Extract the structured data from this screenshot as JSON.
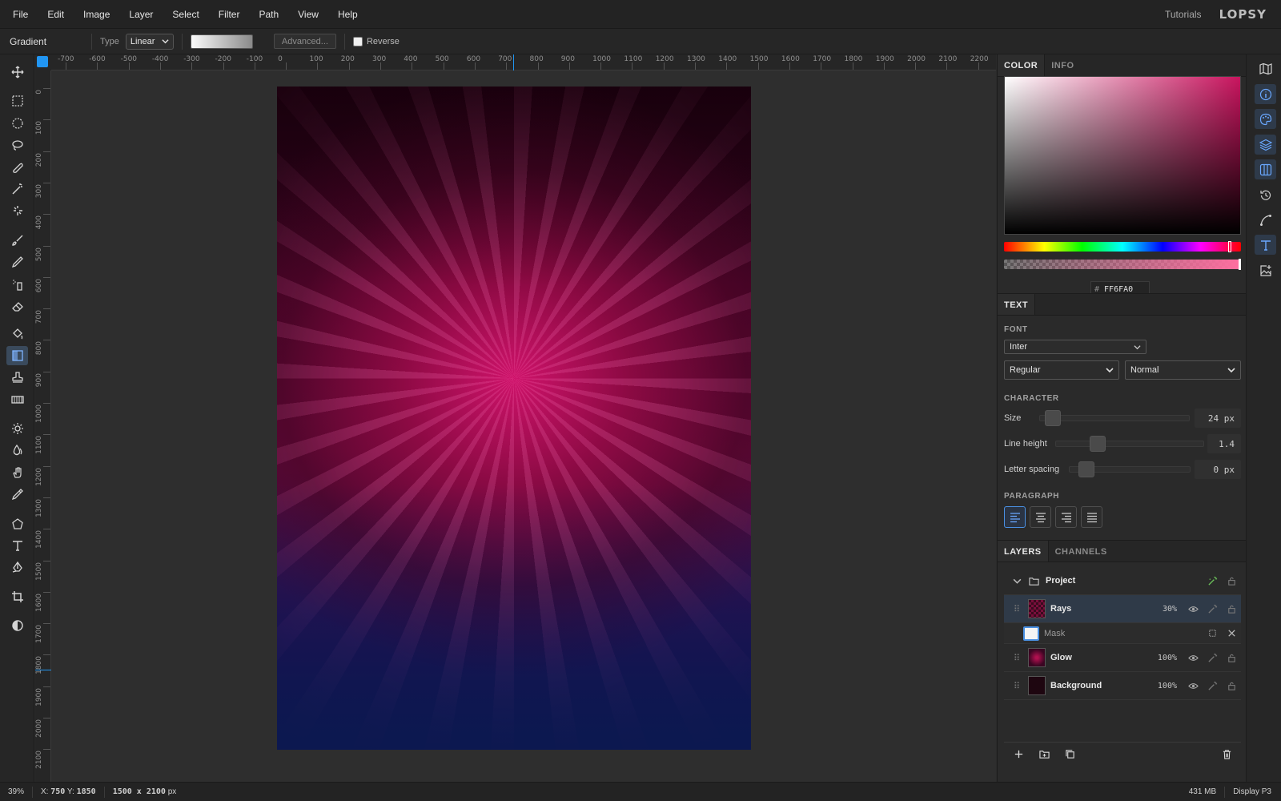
{
  "menubar": {
    "items": [
      "File",
      "Edit",
      "Image",
      "Layer",
      "Select",
      "Filter",
      "Path",
      "View",
      "Help"
    ],
    "tutorials": "Tutorials",
    "logo": "LOPSY"
  },
  "options": {
    "tool_name": "Gradient",
    "type_label": "Type",
    "type_value": "Linear",
    "advanced_label": "Advanced...",
    "reverse_label": "Reverse",
    "reverse_checked": false
  },
  "tools": [
    {
      "name": "move-tool",
      "icon": "move-icon"
    },
    {
      "name": "rect-select-tool",
      "icon": "rect-select-icon"
    },
    {
      "name": "ellipse-select-tool",
      "icon": "ellipse-select-icon"
    },
    {
      "name": "lasso-tool",
      "icon": "lasso-icon"
    },
    {
      "name": "magnetic-lasso-tool",
      "icon": "magnetic-lasso-icon"
    },
    {
      "name": "magic-wand-tool",
      "icon": "magic-wand-icon"
    },
    {
      "name": "quick-select-tool",
      "icon": "quick-select-icon"
    },
    {
      "name": "brush-tool",
      "icon": "brush-icon"
    },
    {
      "name": "pencil-tool",
      "icon": "pencil-icon"
    },
    {
      "name": "spray-tool",
      "icon": "spray-icon"
    },
    {
      "name": "eraser-tool",
      "icon": "eraser-icon"
    },
    {
      "name": "fill-tool",
      "icon": "bucket-icon"
    },
    {
      "name": "gradient-tool",
      "icon": "gradient-icon",
      "active": true
    },
    {
      "name": "stamp-tool",
      "icon": "stamp-icon"
    },
    {
      "name": "pattern-tool",
      "icon": "pattern-icon"
    },
    {
      "name": "dodge-tool",
      "icon": "sun-icon"
    },
    {
      "name": "blur-tool",
      "icon": "drop-icon"
    },
    {
      "name": "smudge-tool",
      "icon": "hand-icon"
    },
    {
      "name": "eyedropper-tool",
      "icon": "eyedropper-icon"
    },
    {
      "name": "shape-tool",
      "icon": "pentagon-icon"
    },
    {
      "name": "text-tool",
      "icon": "text-icon"
    },
    {
      "name": "pen-tool",
      "icon": "pen-icon"
    },
    {
      "name": "crop-tool",
      "icon": "crop-icon"
    },
    {
      "name": "adjust-tool",
      "icon": "contrast-icon"
    }
  ],
  "ruler": {
    "h_labels": [
      "-700",
      "-600",
      "-500",
      "-400",
      "-300",
      "-200",
      "-100",
      "0",
      "100",
      "200",
      "300",
      "400",
      "500",
      "600",
      "700",
      "800",
      "900",
      "1000",
      "1100",
      "1200",
      "1300",
      "1400",
      "1500",
      "1600",
      "1700",
      "1800",
      "1900",
      "2000",
      "2100",
      "2200"
    ],
    "v_labels": [
      "0",
      "100",
      "200",
      "300",
      "400",
      "500",
      "600",
      "700",
      "800",
      "900",
      "1000",
      "1100",
      "1200",
      "1300",
      "1400",
      "1500",
      "1600",
      "1700",
      "1800",
      "1900",
      "2000",
      "2100"
    ]
  },
  "color_panel": {
    "tabs": [
      "COLOR",
      "INFO"
    ],
    "hex_value": "FF6FA0",
    "hue_color": "#c8145e"
  },
  "text_panel": {
    "tab": "TEXT",
    "font_label": "FONT",
    "font_family": "Inter",
    "font_style": "Regular",
    "font_case": "Normal",
    "character_label": "CHARACTER",
    "size_label": "Size",
    "size_value": "24 px",
    "line_height_label": "Line height",
    "line_height_value": "1.4",
    "letter_spacing_label": "Letter spacing",
    "letter_spacing_value": "0 px",
    "paragraph_label": "PARAGRAPH"
  },
  "layers_panel": {
    "tabs": [
      "LAYERS",
      "CHANNELS"
    ],
    "group_name": "Project",
    "layers": [
      {
        "name": "Rays",
        "opacity": "30%"
      },
      {
        "name": "Mask"
      },
      {
        "name": "Glow",
        "opacity": "100%"
      },
      {
        "name": "Background",
        "opacity": "100%"
      }
    ]
  },
  "status": {
    "zoom": "39%",
    "x_label": "X:",
    "x": "750",
    "y_label": "Y:",
    "y": "1850",
    "dims": "1500 x 2100",
    "dims_unit": "px",
    "memory": "431 MB",
    "profile": "Display P3"
  }
}
